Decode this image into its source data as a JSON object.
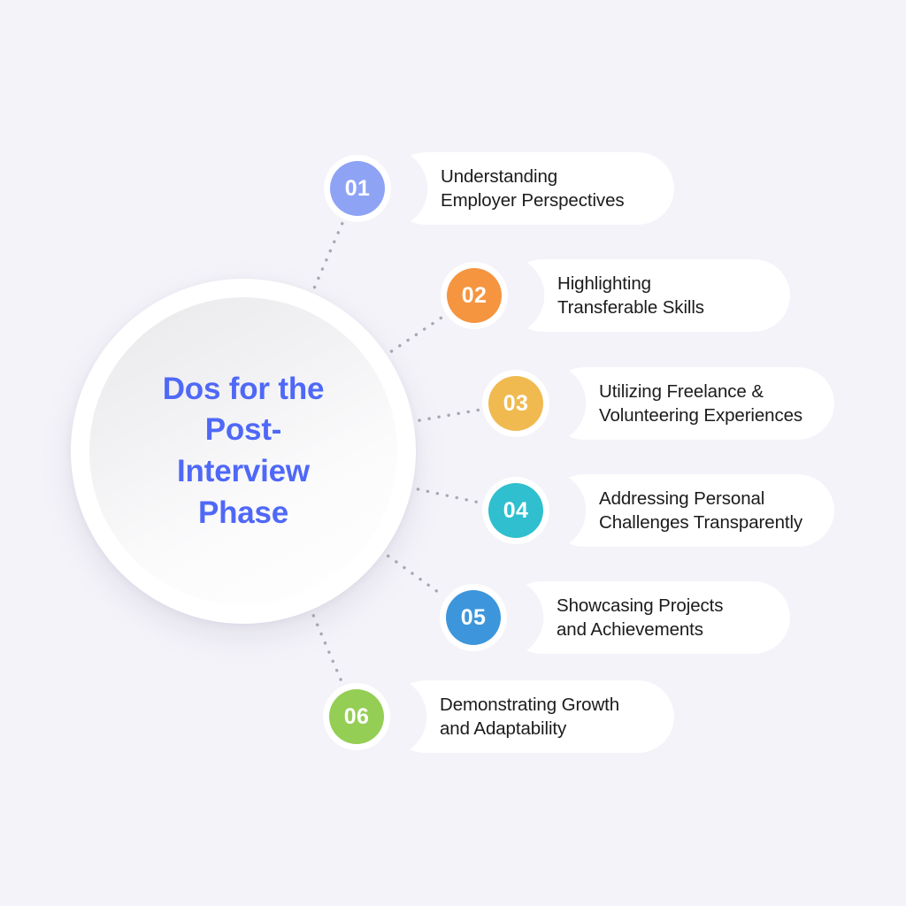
{
  "background_color": "#f4f3f9",
  "hub": {
    "title": "Dos for the\nPost-\nInterview\nPhase",
    "title_color": "#4f68f7"
  },
  "items": [
    {
      "number": "01",
      "label": "Understanding\nEmployer Perspectives",
      "color": "#8fa3f5"
    },
    {
      "number": "02",
      "label": "Highlighting\nTransferable Skills",
      "color": "#f59540"
    },
    {
      "number": "03",
      "label": "Utilizing Freelance &\nVolunteering Experiences",
      "color": "#f0ba50"
    },
    {
      "number": "04",
      "label": "Addressing Personal\nChallenges Transparently",
      "color": "#2fbfce"
    },
    {
      "number": "05",
      "label": "Showcasing Projects\nand Achievements",
      "color": "#3d96db"
    },
    {
      "number": "06",
      "label": "Demonstrating Growth\nand Adaptability",
      "color": "#94ce54"
    }
  ],
  "connector_color": "#a8a8b4"
}
